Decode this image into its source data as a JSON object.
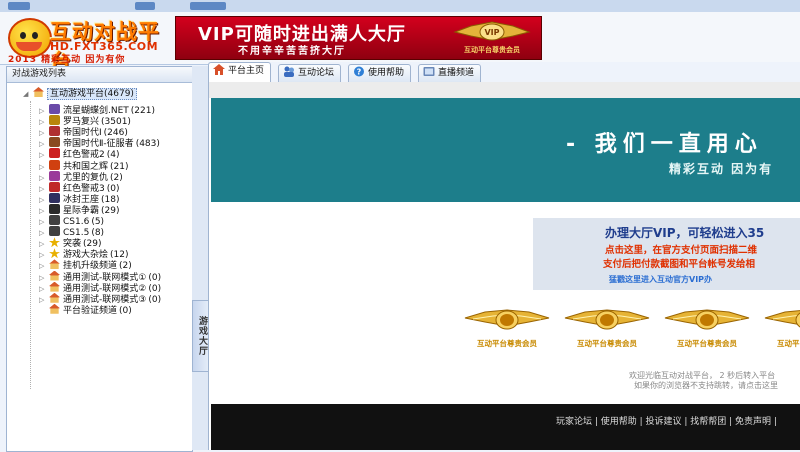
{
  "header": {
    "logo_name": "互动对战平台",
    "logo_url": "HD.FXT365.COM",
    "logo_slogan": "2013 精彩互动 因为有你",
    "banner_main": "VIP可随时进出满人大厅",
    "banner_sub": "不用辛辛苦苦挤大厅",
    "banner_badge_text": "VIP",
    "banner_badge_caption": "互动平台尊贵会员"
  },
  "left_panel": {
    "title": "对战游戏列表",
    "root": {
      "label": "互动游戏平台",
      "count": "(4679)"
    },
    "items": [
      {
        "label": "流星蝴蝶剑.NET",
        "count": "(221)",
        "icon": "butterfly-sword-icon",
        "color": "#6a4aa8"
      },
      {
        "label": "罗马复兴",
        "count": "(3501)",
        "icon": "rome-helmet-icon",
        "color": "#b8860b"
      },
      {
        "label": "帝国时代Ⅰ",
        "count": "(246)",
        "icon": "empire-flag-icon",
        "color": "#b03030"
      },
      {
        "label": "帝国时代Ⅱ-征服者",
        "count": "(483)",
        "icon": "empire-crown-icon",
        "color": "#8a4a20"
      },
      {
        "label": "红色警戒2",
        "count": "(4)",
        "icon": "red-alert-icon",
        "color": "#cc2020"
      },
      {
        "label": "共和国之辉",
        "count": "(21)",
        "icon": "republic-star-icon",
        "color": "#d04010"
      },
      {
        "label": "尤里的复仇",
        "count": "(2)",
        "icon": "yuri-icon",
        "color": "#9a3a9a"
      },
      {
        "label": "红色警戒3",
        "count": "(0)",
        "icon": "red-alert-3-icon",
        "color": "#c02828"
      },
      {
        "label": "冰封王座",
        "count": "(18)",
        "icon": "frozen-throne-icon",
        "color": "#303060"
      },
      {
        "label": "星际争霸",
        "count": "(29)",
        "icon": "starcraft-icon",
        "color": "#2a2a2a"
      },
      {
        "label": "CS1.6",
        "count": "(5)",
        "icon": "cs-soldier-icon",
        "color": "#404040"
      },
      {
        "label": "CS1.5",
        "count": "(8)",
        "icon": "cs-soldier-icon",
        "color": "#404040"
      },
      {
        "label": "突袭",
        "count": "(29)",
        "icon": "star-icon",
        "color": "#e8b000"
      },
      {
        "label": "游戏大杂烩",
        "count": "(12)",
        "icon": "star-icon",
        "color": "#e8b000"
      },
      {
        "label": "挂机升级频道",
        "count": "(2)",
        "icon": "house-icon",
        "color": "#d85b2a"
      },
      {
        "label": "通用测试-联网模式①",
        "count": "(0)",
        "icon": "house-icon",
        "color": "#d85b2a"
      },
      {
        "label": "通用测试-联网模式②",
        "count": "(0)",
        "icon": "house-icon",
        "color": "#d85b2a"
      },
      {
        "label": "通用测试-联网模式③",
        "count": "(0)",
        "icon": "house-icon",
        "color": "#d85b2a"
      },
      {
        "label": "平台验证频道",
        "count": "(0)",
        "icon": "house-icon",
        "color": "#d85b2a"
      }
    ],
    "side_tab_label": "游戏大厅"
  },
  "tabs": [
    {
      "label": "平台主页",
      "icon": "home-icon",
      "active": true
    },
    {
      "label": "互动论坛",
      "icon": "forum-icon",
      "active": false
    },
    {
      "label": "使用帮助",
      "icon": "help-icon",
      "active": false
    },
    {
      "label": "直播频道",
      "icon": "broadcast-icon",
      "active": false
    }
  ],
  "web": {
    "hero_title": "- 我们一直用心",
    "hero_sub": "精彩互动 因为有",
    "vip_title": "办理大厅VIP，可轻松进入35",
    "vip_line1": "点击这里，在官方支付页面扫描二维",
    "vip_line2": "支付后把付款截图和平台帐号发给相",
    "vip_link": "猛戳这里进入互动官方VIP办",
    "badges": [
      {
        "caption": "互动平台尊贵会员"
      },
      {
        "caption": "互动平台尊贵会员"
      },
      {
        "caption": "互动平台尊贵会员"
      },
      {
        "caption": "互动平台尊贵会员"
      }
    ],
    "welcome_line1": "欢迎光临互动对战平台，  2  秒后转入平台",
    "welcome_line2": "如果你的浏览器不支持跳转，请点击这里",
    "footer_links": "玩家论坛 | 使用帮助 | 投诉建议 | 找帮帮团 | 免责声明 |"
  }
}
